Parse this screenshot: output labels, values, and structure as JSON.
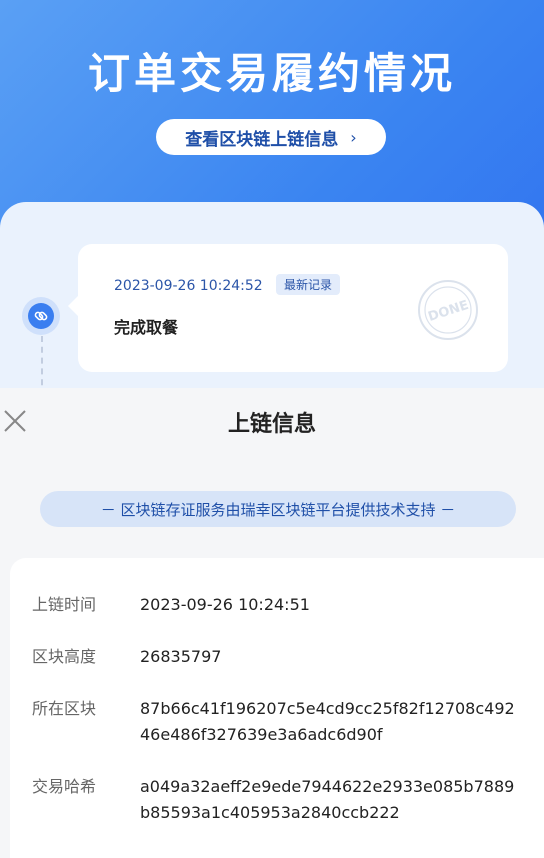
{
  "hero": {
    "title": "订单交易履约情况",
    "chain_button_label": "查看区块链上链信息",
    "chain_button_chevron": "›"
  },
  "timeline": {
    "time": "2023-09-26 10:24:52",
    "badge": "最新记录",
    "status": "完成取餐",
    "stamp_text": "DONE"
  },
  "sheet": {
    "title": "上链信息",
    "notice": "－ 区块链存证服务由瑞幸区块链平台提供技术支持 －",
    "rows": [
      {
        "label": "上链时间",
        "value": "2023-09-26 10:24:51"
      },
      {
        "label": "区块高度",
        "value": "26835797"
      },
      {
        "label": "所在区块",
        "value": "87b66c41f196207c5e4cd9cc25f82f12708c49246e486f327639e3a6adc6d90f"
      },
      {
        "label": "交易哈希",
        "value": "a049a32aeff2e9ede7944622e2933e085b7889b85593a1c405953a2840ccb222"
      }
    ]
  },
  "colors": {
    "brand_blue": "#3a84f1",
    "link_blue": "#1f4fa8"
  }
}
